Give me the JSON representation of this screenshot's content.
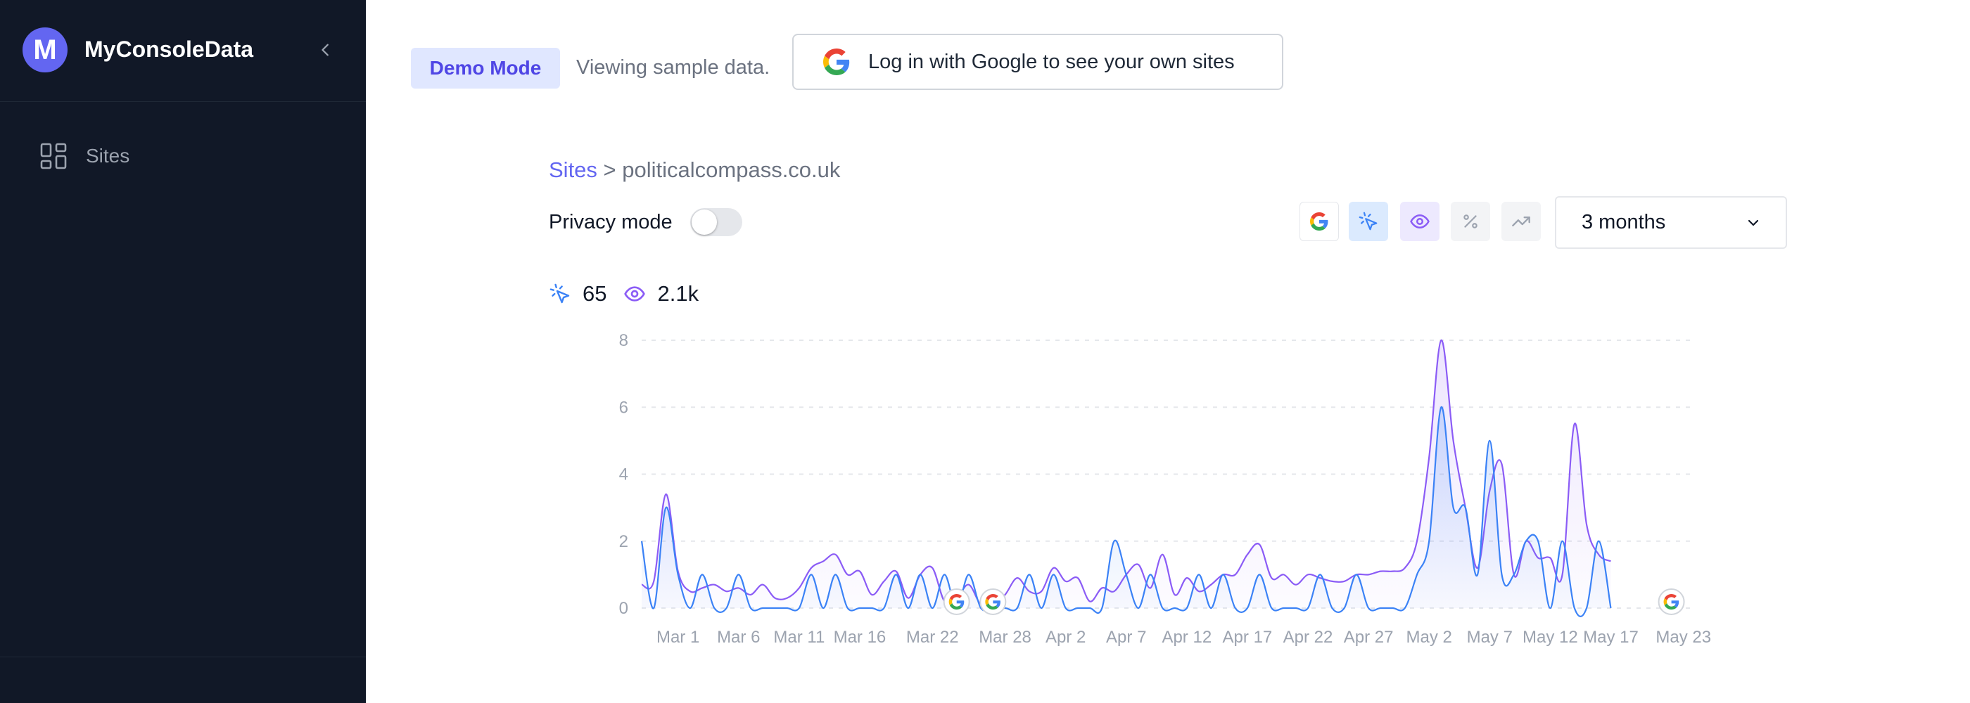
{
  "app": {
    "title": "MyConsoleData",
    "logo_letter": "M"
  },
  "sidebar": {
    "items": [
      {
        "label": "Sites",
        "icon": "grid-icon"
      }
    ]
  },
  "banner": {
    "badge": "Demo Mode",
    "text": "Viewing sample data.",
    "login_button": "Log in with Google to see your own sites"
  },
  "breadcrumb": {
    "root": "Sites",
    "separator": " > ",
    "current": "politicalcompass.co.uk"
  },
  "privacy": {
    "label": "Privacy mode",
    "enabled": false
  },
  "toolbar": {
    "buttons": [
      {
        "icon": "google-icon",
        "active": false
      },
      {
        "icon": "click-icon",
        "active": true
      },
      {
        "icon": "eye-icon",
        "active": true
      },
      {
        "icon": "percent-icon",
        "active": false
      },
      {
        "icon": "trend-icon",
        "active": false
      }
    ],
    "range": "3 months"
  },
  "summary": {
    "clicks": "65",
    "impressions": "2.1k"
  },
  "colors": {
    "accent": "#6366f1",
    "clicks": "#3b82f6",
    "impressions": "#8b5cf6",
    "sidebar": "#111827"
  },
  "chart_data": {
    "type": "area",
    "ylim": [
      0,
      8
    ],
    "yticks": [
      0,
      2,
      4,
      6,
      8
    ],
    "xticks": [
      "Mar 1",
      "Mar 6",
      "Mar 11",
      "Mar 16",
      "Mar 22",
      "Mar 28",
      "Apr 2",
      "Apr 7",
      "Apr 12",
      "Apr 17",
      "Apr 22",
      "Apr 27",
      "May 2",
      "May 7",
      "May 12",
      "May 17",
      "May 23"
    ],
    "xtick_days": [
      3,
      8,
      13,
      18,
      24,
      30,
      35,
      40,
      45,
      50,
      55,
      60,
      65,
      70,
      75,
      80,
      86
    ],
    "x_days": [
      0,
      1,
      2,
      3,
      4,
      5,
      6,
      7,
      8,
      9,
      10,
      11,
      12,
      13,
      14,
      15,
      16,
      17,
      18,
      19,
      20,
      21,
      22,
      23,
      24,
      25,
      26,
      27,
      28,
      29,
      30,
      31,
      32,
      33,
      34,
      35,
      36,
      37,
      38,
      39,
      40,
      41,
      42,
      43,
      44,
      45,
      46,
      47,
      48,
      49,
      50,
      51,
      52,
      53,
      54,
      55,
      56,
      57,
      58,
      59,
      60,
      61,
      62,
      63,
      64,
      65,
      66,
      67,
      68,
      69,
      70,
      71,
      72,
      73,
      74,
      75,
      76,
      77,
      78,
      79,
      80,
      81,
      82,
      83,
      84,
      85,
      86,
      87
    ],
    "series": [
      {
        "values": [
          0.7,
          0.8,
          3.4,
          1.1,
          0.5,
          0.6,
          0.7,
          0.5,
          0.6,
          0.4,
          0.7,
          0.3,
          0.3,
          0.6,
          1.2,
          1.4,
          1.6,
          1.0,
          1.1,
          0.4,
          0.8,
          1.1,
          0.3,
          1.0,
          1.2,
          0.2,
          0.3,
          0.7,
          0.1,
          0.1,
          0.4,
          0.9,
          0.5,
          0.5,
          1.2,
          0.8,
          0.9,
          0.2,
          0.6,
          0.5,
          1.0,
          1.3,
          0.6,
          1.6,
          0.4,
          0.9,
          0.5,
          0.7,
          1.0,
          1.0,
          1.6,
          1.9,
          0.9,
          1.0,
          0.7,
          1.0,
          0.9,
          0.8,
          0.8,
          1.0,
          1.0,
          1.1,
          1.1,
          1.2,
          2.0,
          4.5,
          8.0,
          5.0,
          3.0,
          1.2,
          3.5,
          4.3,
          1.0,
          2.0,
          1.5,
          1.5,
          1.0,
          5.5,
          2.5,
          1.6,
          1.4
        ]
      },
      {
        "values": [
          2,
          0,
          3,
          1,
          0,
          1,
          0,
          0,
          1,
          0,
          0,
          0,
          0,
          0,
          1,
          0,
          1,
          0,
          0,
          0,
          0,
          1,
          0,
          1,
          0,
          1,
          0,
          1,
          0,
          0,
          0,
          0,
          1,
          0,
          1,
          0,
          0,
          0,
          0,
          2,
          1,
          0,
          1,
          0,
          0,
          0,
          1,
          0,
          1,
          0,
          0,
          1,
          0,
          0,
          0,
          0,
          1,
          0,
          0,
          1,
          0,
          0,
          0,
          0,
          1,
          2,
          6,
          3,
          3,
          1,
          5,
          1,
          1,
          2,
          2,
          0,
          2,
          0,
          0,
          2,
          0
        ]
      }
    ],
    "annotation_days": [
      26,
      29,
      85
    ]
  }
}
